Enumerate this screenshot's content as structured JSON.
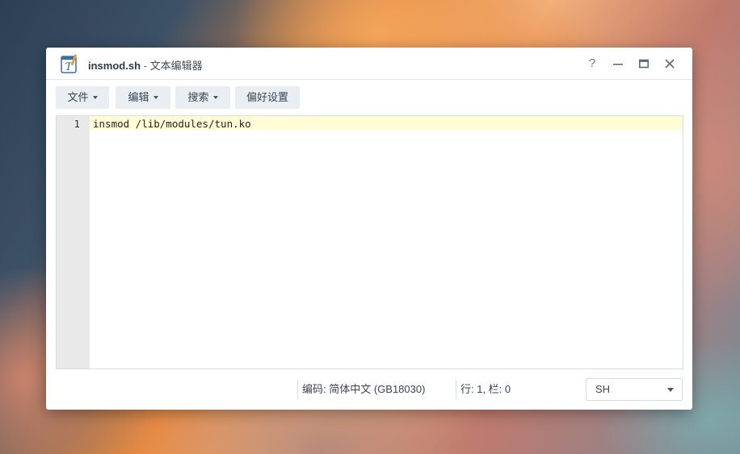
{
  "window": {
    "file_name": "insmod.sh",
    "separator": " - ",
    "app_name": "文本编辑器",
    "controls": {
      "help": "?",
      "minimize": "—",
      "maximize": "□",
      "close": "✕"
    }
  },
  "toolbar": {
    "file_label": "文件",
    "edit_label": "编辑",
    "search_label": "搜索",
    "prefs_label": "偏好设置"
  },
  "editor": {
    "lines": [
      {
        "number": "1",
        "text": "insmod /lib/modules/tun.ko"
      }
    ],
    "active_line_color": "#fffcd6"
  },
  "statusbar": {
    "encoding": "编码: 简体中文 (GB18030)",
    "position": "行: 1, 栏: 0",
    "language": "SH"
  },
  "icons": {
    "app": "text-editor-icon",
    "caret": "chevron-down-icon"
  }
}
